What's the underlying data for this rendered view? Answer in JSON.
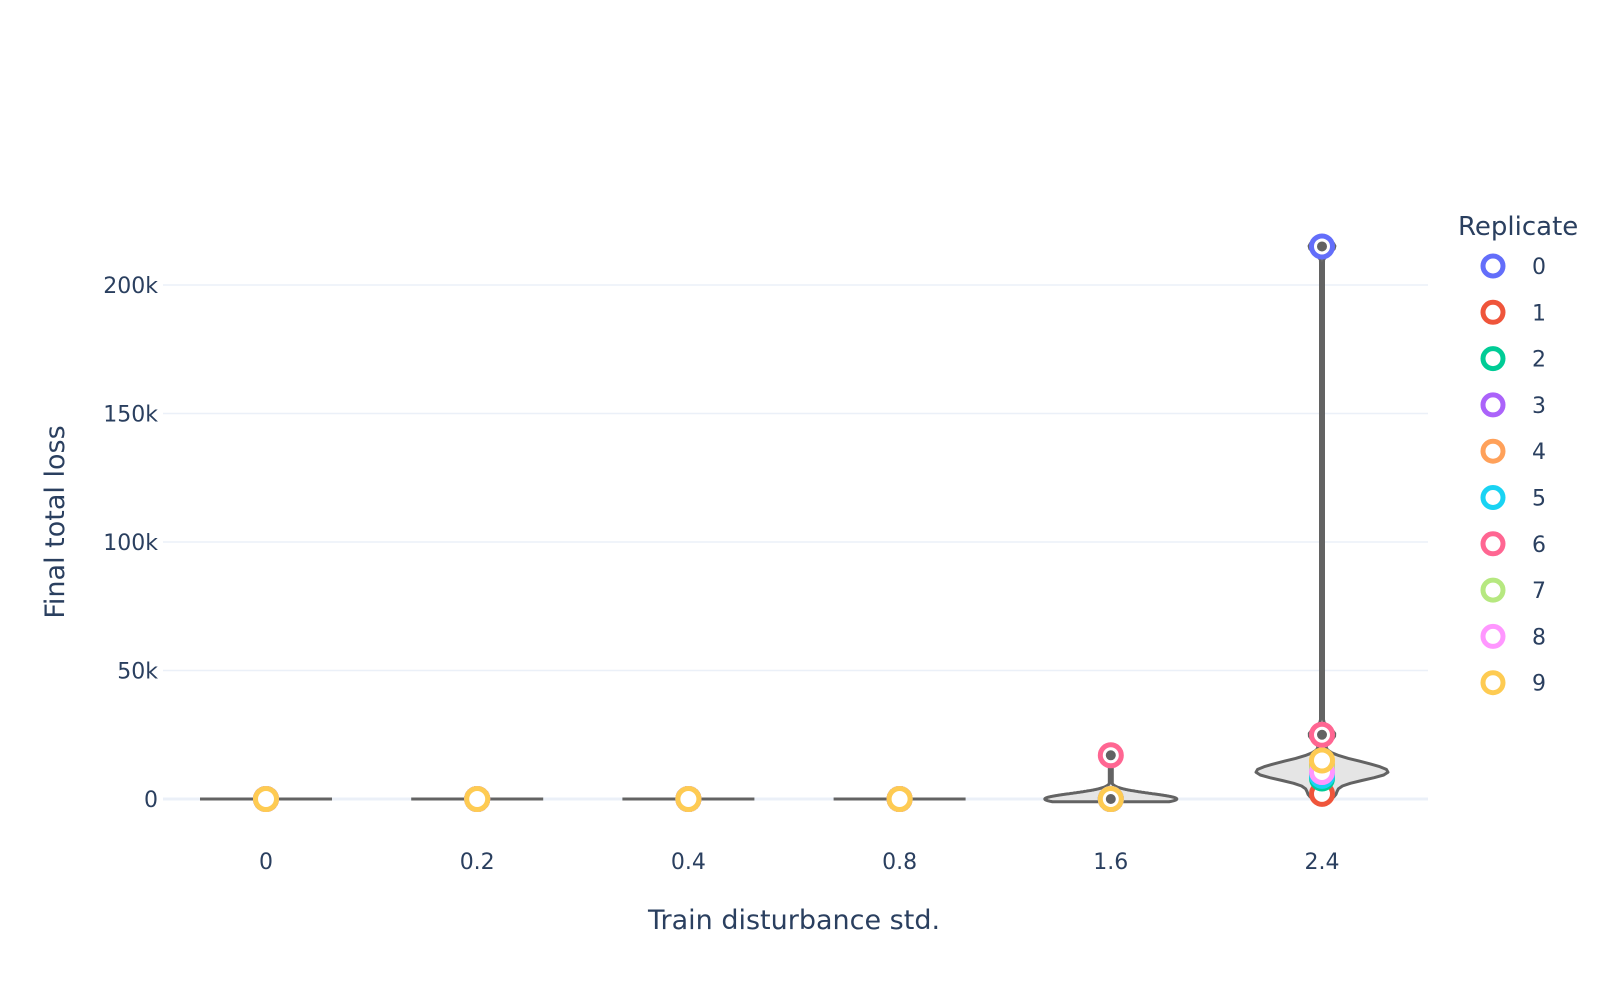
{
  "chart_data": {
    "type": "violin",
    "xlabel": "Train disturbance std.",
    "ylabel": "Final total loss",
    "categories": [
      "0",
      "0.2",
      "0.4",
      "0.8",
      "1.6",
      "2.4"
    ],
    "y_ticks": [
      0,
      50000,
      100000,
      150000,
      200000
    ],
    "y_tick_labels": [
      "0",
      "50k",
      "100k",
      "150k",
      "200k"
    ],
    "ylim": [
      -17000,
      232000
    ],
    "grid": true,
    "legend_title": "Replicate",
    "legend_placement": "right",
    "series": [
      {
        "name": "0",
        "color": "#636efa",
        "values": [
          0,
          0,
          0,
          0,
          0,
          215000
        ]
      },
      {
        "name": "1",
        "color": "#ef553b",
        "values": [
          0,
          0,
          0,
          0,
          0,
          2000
        ]
      },
      {
        "name": "2",
        "color": "#00cc96",
        "values": [
          0,
          0,
          0,
          0,
          0,
          8000
        ]
      },
      {
        "name": "3",
        "color": "#ab63fa",
        "values": [
          0,
          0,
          0,
          0,
          0,
          10000
        ]
      },
      {
        "name": "4",
        "color": "#ffa15a",
        "values": [
          0,
          0,
          0,
          0,
          0,
          13000
        ]
      },
      {
        "name": "5",
        "color": "#19d3f3",
        "values": [
          0,
          0,
          0,
          0,
          0,
          9000
        ]
      },
      {
        "name": "6",
        "color": "#ff6692",
        "values": [
          0,
          0,
          0,
          0,
          17000,
          25000
        ]
      },
      {
        "name": "7",
        "color": "#b6e880",
        "values": [
          0,
          0,
          0,
          0,
          0,
          12000
        ]
      },
      {
        "name": "8",
        "color": "#ff97ff",
        "values": [
          0,
          0,
          0,
          0,
          0,
          10500
        ]
      },
      {
        "name": "9",
        "color": "#fecb52",
        "values": [
          0,
          0,
          0,
          0,
          0,
          15000
        ]
      }
    ],
    "violin_color": "#636363",
    "violin_fill": "#e5e5e5"
  }
}
